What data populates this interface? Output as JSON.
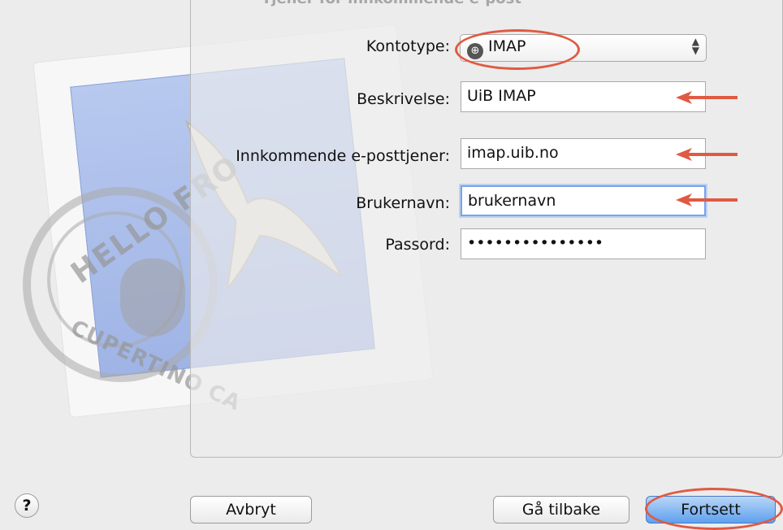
{
  "header": {
    "title": "Tjener for innkommende e-post"
  },
  "stamp": {
    "postmark_top": "HELLO FRO",
    "postmark_bottom": "CUPERTINO CA"
  },
  "form": {
    "account_type": {
      "label": "Kontotype:",
      "value": "IMAP"
    },
    "description": {
      "label": "Beskrivelse:",
      "value": "UiB IMAP"
    },
    "incoming_server": {
      "label": "Innkommende e-posttjener:",
      "value": "imap.uib.no"
    },
    "username": {
      "label": "Brukernavn:",
      "value": "brukernavn"
    },
    "password": {
      "label": "Passord:",
      "value": "•••••••••••••••"
    }
  },
  "buttons": {
    "help": "?",
    "cancel": "Avbryt",
    "back": "Gå tilbake",
    "continue": "Fortsett"
  },
  "colors": {
    "annotation_red": "#e05a43",
    "focus_blue": "#7aa3e6",
    "default_button_blue": "#5ea1ee"
  },
  "icons": {
    "account_type": "globe-icon",
    "select_arrows": "updown-arrows-icon",
    "annotation": "red-arrow-icon"
  }
}
